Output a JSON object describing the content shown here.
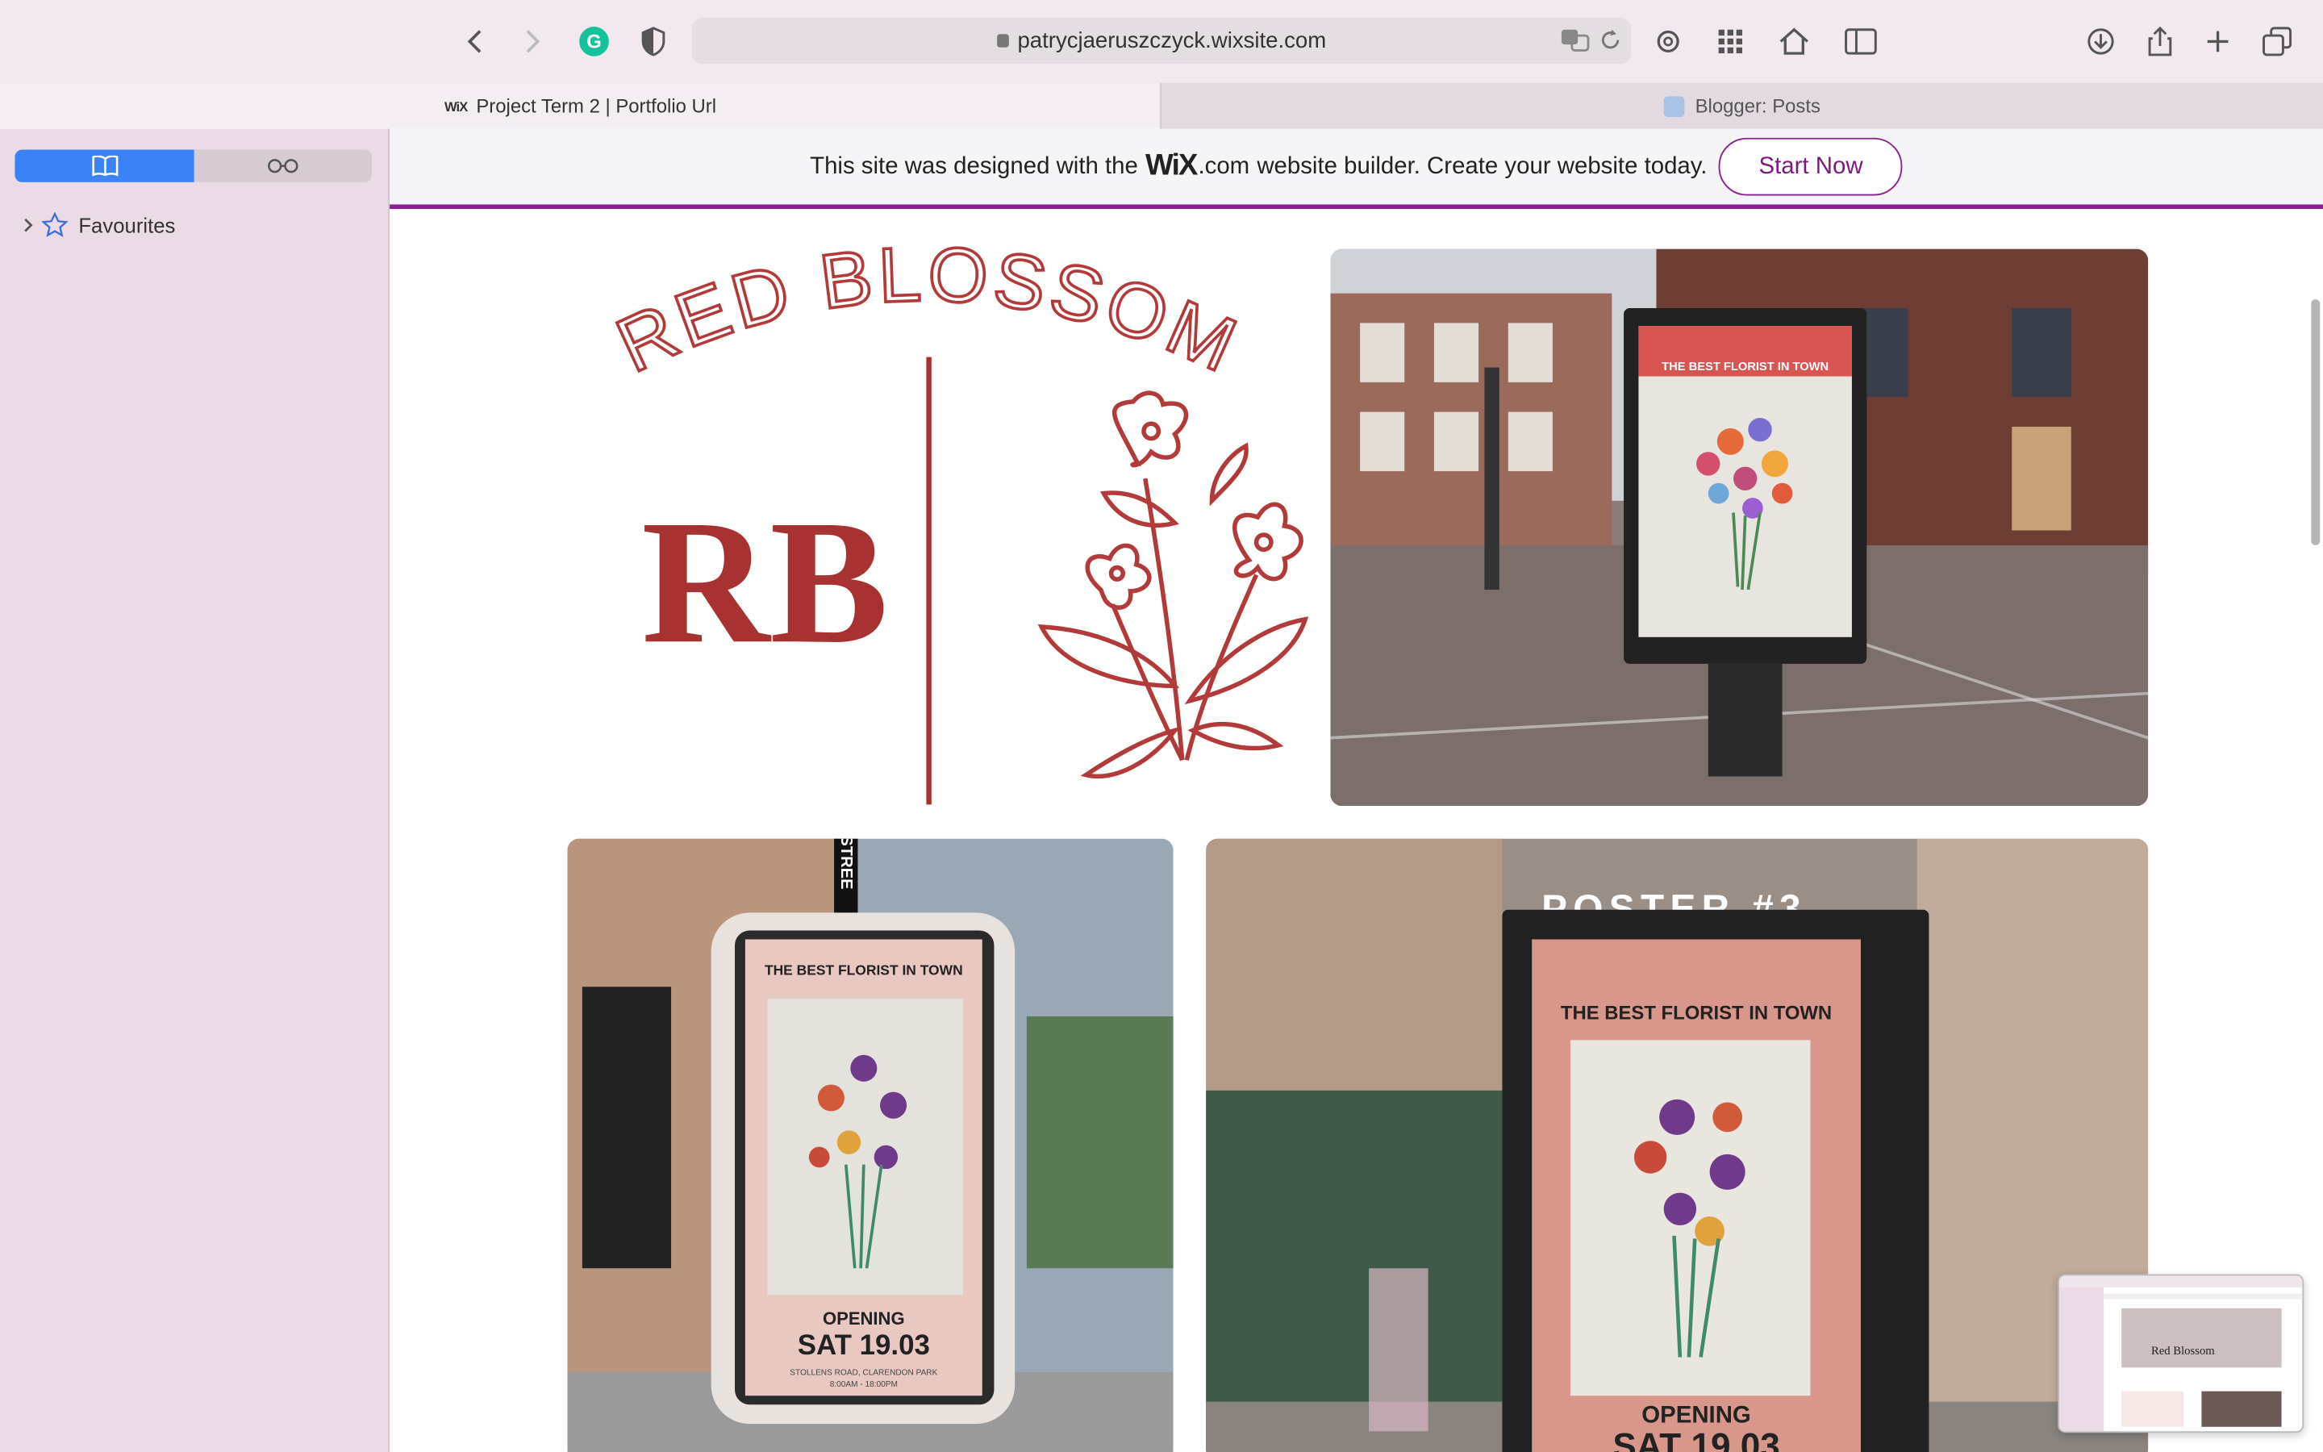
{
  "browser": {
    "url": "patrycjaeruszczyck.wixsite.com",
    "tabs": [
      {
        "label": "Project Term 2 | Portfolio Url",
        "active": true
      },
      {
        "label": "Blogger: Posts",
        "active": false
      }
    ]
  },
  "sidebar": {
    "favourites_label": "Favourites"
  },
  "banner": {
    "text_before": "This site was designed with the",
    "logo_text": "WiX",
    "logo_suffix": ".com",
    "text_after": "website builder. Create your website today.",
    "cta_label": "Start Now",
    "accent": "#8a1d8f"
  },
  "gallery": {
    "logo_arc_text": "RED BLOSSOM",
    "logo_monogram": "RB",
    "poster_headline": "THE BEST FLORIST IN TOWN",
    "poster_opening": "OPENING",
    "poster_date": "SAT 19.03",
    "poster_address": "STOLLENS ROAD, CLARENDON PARK",
    "poster_hours": "8:00AM - 18:00PM",
    "poster3_title": "POSTER #3",
    "poster3_date_partial": "SAT 19.03",
    "street_sign": "STREE",
    "brand_color": "#b23a3a"
  },
  "thumbnail": {
    "label": "Red Blossom"
  }
}
